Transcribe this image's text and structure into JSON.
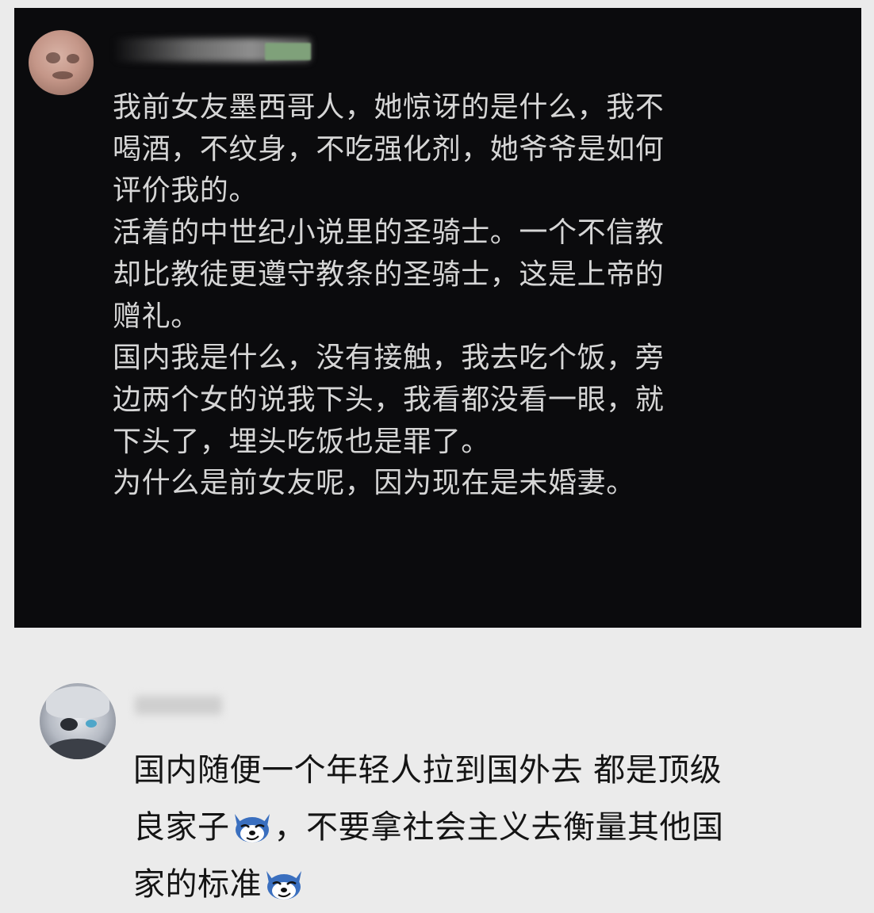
{
  "post": {
    "lines": [
      "我前女友墨西哥人，她惊讶的是什么，我不",
      "喝酒，不纹身，不吃强化剂，她爷爷是如何",
      "评价我的。",
      "活着的中世纪小说里的圣骑士。一个不信教",
      "却比教徒更遵守教条的圣骑士，这是上帝的",
      "赠礼。",
      "国内我是什么，没有接触，我去吃个饭，旁",
      "边两个女的说我下头，我看都没看一眼，就",
      "下头了，埋头吃饭也是罪了。",
      "为什么是前女友呢，因为现在是未婚妻。"
    ],
    "avatar_icon": "user-avatar",
    "username_redacted": true
  },
  "comment": {
    "line1": "国内随便一个年轻人拉到国外去 都是顶级",
    "line2a": "良家子",
    "line2b": "，不要拿社会主义去衡量其他国",
    "line3": "家的标准",
    "emoji_icon": "husky-smirk-emoji",
    "avatar_icon": "anime-character-avatar",
    "username_redacted": true
  },
  "colors": {
    "page_bg": "#ebebeb",
    "card_bg": "#0b0b0d",
    "post_text": "#d6d6d6",
    "comment_text": "#141414"
  }
}
